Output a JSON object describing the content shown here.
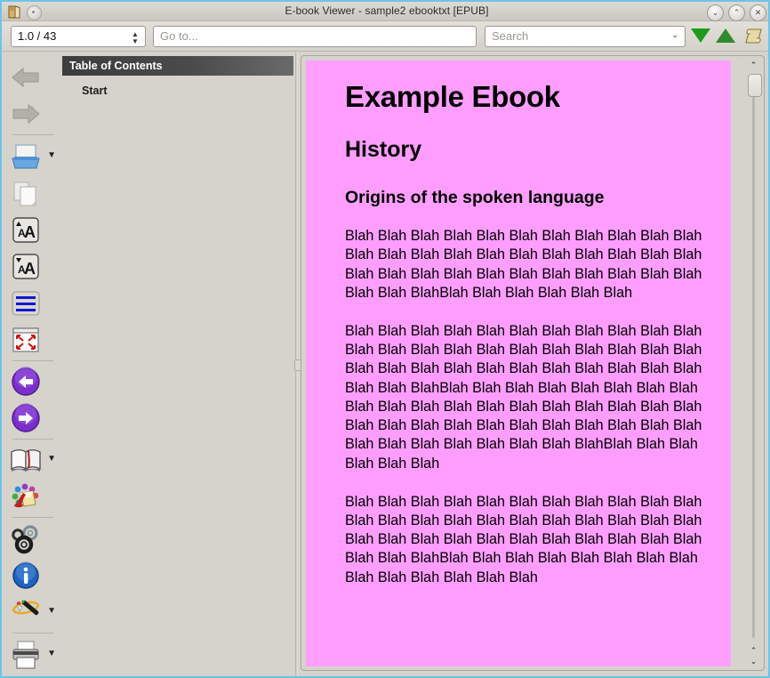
{
  "window": {
    "title": "E-book Viewer - sample2 ebooktxt [EPUB]",
    "app_icon": "book-app-icon",
    "controls": {
      "minimize": "⌄",
      "maximize": "⌃",
      "close": "✕"
    }
  },
  "toolbar": {
    "position_value": "1.0 / 43",
    "goto_placeholder": "Go to...",
    "search_placeholder": "Search",
    "search_dropdown_glyph": "⌄",
    "find_next_label": "find-next",
    "find_previous_label": "find-previous",
    "reference_mode_label": "reference-mode"
  },
  "sidebar": {
    "items": [
      {
        "name": "back",
        "icon": "gray-left-arrow-icon",
        "caret": false
      },
      {
        "name": "forward",
        "icon": "gray-right-arrow-icon",
        "caret": false
      },
      {
        "name": "open-ebook",
        "icon": "open-folder-icon",
        "caret": true,
        "caret_glyph": "⌄"
      },
      {
        "name": "copy",
        "icon": "copy-pages-icon",
        "caret": false
      },
      {
        "name": "increase-font-size",
        "icon": "font-larger-icon",
        "caret": false
      },
      {
        "name": "decrease-font-size",
        "icon": "font-smaller-icon",
        "caret": false
      },
      {
        "name": "toggle-paged-mode",
        "icon": "paged-lines-icon",
        "caret": false
      },
      {
        "name": "fullscreen",
        "icon": "fullscreen-arrows-icon",
        "caret": false
      },
      {
        "name": "previous-page",
        "icon": "purple-back-arrow-icon",
        "caret": false
      },
      {
        "name": "next-page",
        "icon": "purple-forward-arrow-icon",
        "caret": false
      },
      {
        "name": "bookmarks",
        "icon": "open-book-icon",
        "caret": true,
        "caret_glyph": "⌄"
      },
      {
        "name": "highlight",
        "icon": "paint-bucket-icon",
        "caret": false
      },
      {
        "name": "preferences",
        "icon": "gears-icon",
        "caret": false
      },
      {
        "name": "metadata",
        "icon": "info-icon",
        "caret": false
      },
      {
        "name": "tools",
        "icon": "magic-wand-icon",
        "caret": true,
        "caret_glyph": "⌄"
      },
      {
        "name": "print",
        "icon": "printer-icon",
        "caret": true,
        "caret_glyph": "⌄"
      }
    ]
  },
  "toc": {
    "header": "Table of Contents",
    "entries": [
      {
        "label": "Start"
      }
    ]
  },
  "document": {
    "title": "Example Ebook",
    "chapter": "History",
    "section": "Origins of the spoken language",
    "paragraphs": [
      "Blah Blah Blah Blah Blah Blah Blah Blah Blah Blah Blah Blah Blah Blah Blah Blah Blah Blah Blah Blah Blah Blah Blah Blah Blah Blah Blah Blah Blah Blah Blah Blah Blah Blah Blah BlahBlah Blah Blah Blah Blah Blah",
      "Blah Blah Blah Blah Blah Blah Blah Blah Blah Blah Blah Blah Blah Blah Blah Blah Blah Blah Blah Blah Blah Blah Blah Blah Blah Blah Blah Blah Blah Blah Blah Blah Blah Blah Blah BlahBlah Blah Blah Blah Blah Blah Blah Blah Blah Blah Blah Blah Blah Blah Blah Blah Blah Blah Blah Blah Blah Blah Blah Blah Blah Blah Blah Blah Blah Blah Blah Blah Blah Blah Blah Blah Blah BlahBlah Blah Blah Blah Blah Blah",
      "Blah Blah Blah Blah Blah Blah Blah Blah Blah Blah Blah Blah Blah Blah Blah Blah Blah Blah Blah Blah Blah Blah Blah Blah Blah Blah Blah Blah Blah Blah Blah Blah Blah Blah Blah BlahBlah Blah Blah Blah Blah Blah Blah Blah Blah Blah Blah Blah Blah Blah"
    ],
    "background_color": "#ff9eff",
    "text_color": "#000000"
  },
  "scrollbar": {
    "up_glyph": "⌃",
    "down_glyph": "⌄"
  }
}
